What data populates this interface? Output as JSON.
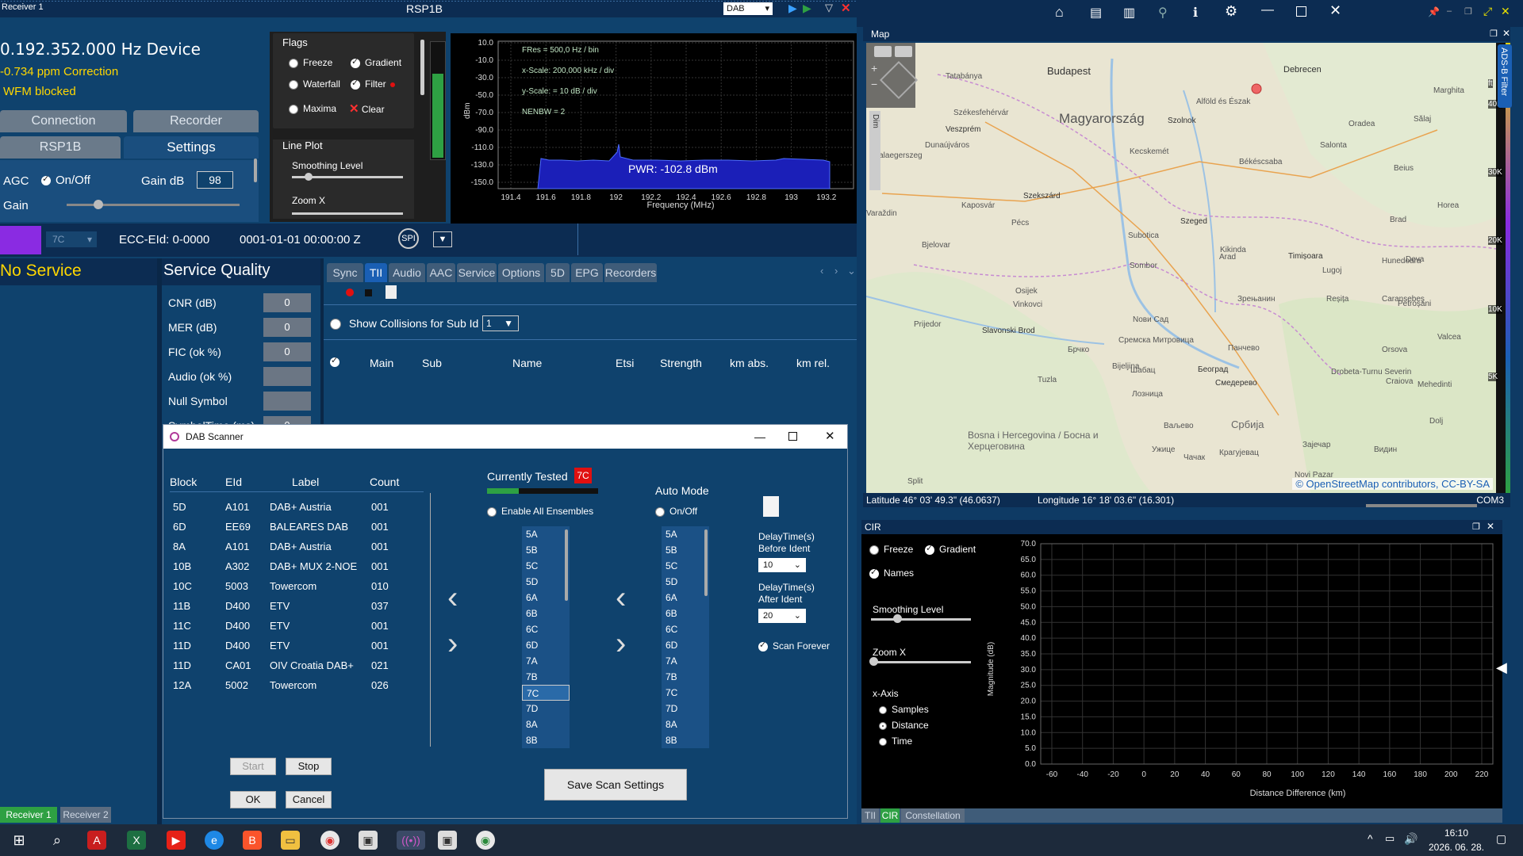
{
  "receiver": {
    "window_title": "Receiver 1",
    "device_title": "RSP1B",
    "mode": "DAB",
    "freq_line": "0.192.352.000 Hz Device",
    "ppm_line": "-0.734 ppm Correction",
    "wfm_line": "WFM blocked",
    "tabs": [
      "Connection",
      "Recorder",
      "RSP1B",
      "Settings"
    ],
    "agc_label": "AGC",
    "agc_toggle": "On/Off",
    "gain_db_label": "Gain dB",
    "gain_db_value": "98",
    "gain_label": "Gain"
  },
  "flags": {
    "title": "Flags",
    "freeze": "Freeze",
    "gradient": "Gradient",
    "waterfall": "Waterfall",
    "filter": "Filter",
    "maxima": "Maxima",
    "clear": "Clear"
  },
  "lineplot": {
    "title": "Line Plot",
    "smoothing": "Smoothing Level",
    "zoom": "Zoom X"
  },
  "spectrum": {
    "info": [
      "FRes = 500,0 Hz / bin",
      "x-Scale: 200,000 kHz / div",
      "y-Scale: = 10 dB / div",
      "NENBW = 2"
    ],
    "pwr": "PWR: -102.8 dBm",
    "ylabel": "dBm",
    "xlabel": "Frequency (MHz)",
    "yticks": [
      "10.0",
      "-10.0",
      "-30.0",
      "-50.0",
      "-70.0",
      "-90.0",
      "-110.0",
      "-130.0",
      "-150.0"
    ],
    "xticks": [
      "191.4",
      "191.6",
      "191.8",
      "192",
      "192.2",
      "192.4",
      "192.6",
      "192.8",
      "193",
      "193.2"
    ]
  },
  "status": {
    "channel": "7C",
    "ecc": "ECC-EId: 0-0000",
    "datetime": "0001-01-01  00:00:00 Z",
    "spi": "SPI",
    "no_service": "No Service"
  },
  "quality": {
    "title": "Service Quality",
    "rows": [
      {
        "label": "CNR (dB)",
        "value": "0"
      },
      {
        "label": "MER (dB)",
        "value": "0"
      },
      {
        "label": "FIC (ok %)",
        "value": "0"
      },
      {
        "label": "Audio (ok %)",
        "value": ""
      },
      {
        "label": "Null Symbol",
        "value": ""
      },
      {
        "label": "SymbolTime (ms)",
        "value": "0"
      }
    ]
  },
  "tii": {
    "tabs": [
      "Sync",
      "TII",
      "Audio",
      "AAC",
      "Service",
      "Options",
      "5D",
      "EPG",
      "Recorders"
    ],
    "collisions_label": "Show Collisions for Sub Id",
    "collisions_value": "1",
    "columns": [
      "Main",
      "Sub",
      "Name",
      "Etsi",
      "Strength",
      "km abs.",
      "km rel."
    ]
  },
  "scanner": {
    "title": "DAB Scanner",
    "headers": [
      "Block",
      "EId",
      "Label",
      "Count"
    ],
    "rows": [
      [
        "5D",
        "A101",
        "DAB+ Austria",
        "001"
      ],
      [
        "6D",
        "EE69",
        "BALEARES DAB",
        "001"
      ],
      [
        "8A",
        "A101",
        "DAB+ Austria",
        "001"
      ],
      [
        "10B",
        "A302",
        "DAB+ MUX 2-NOE",
        "001"
      ],
      [
        "10C",
        "5003",
        "Towercom",
        "010"
      ],
      [
        "11B",
        "D400",
        "ETV",
        "037"
      ],
      [
        "11C",
        "D400",
        "ETV",
        "001"
      ],
      [
        "11D",
        "D400",
        "ETV",
        "001"
      ],
      [
        "11D",
        "CA01",
        "OIV Croatia DAB+",
        "021"
      ],
      [
        "12A",
        "5002",
        "Towercom",
        "026"
      ]
    ],
    "currently_tested_label": "Currently Tested",
    "currently_tested_value": "7C",
    "enable_all": "Enable All Ensembles",
    "auto_mode": "Auto Mode",
    "auto_onoff": "On/Off",
    "channels": [
      "5A",
      "5B",
      "5C",
      "5D",
      "6A",
      "6B",
      "6C",
      "6D",
      "7A",
      "7B",
      "7C",
      "7D",
      "8A",
      "8B"
    ],
    "delay_before_label": "DelayTime(s) Before Ident",
    "delay_before_value": "10",
    "delay_after_label": "DelayTime(s) After Ident",
    "delay_after_value": "20",
    "scan_forever": "Scan Forever",
    "start": "Start",
    "stop": "Stop",
    "ok": "OK",
    "cancel": "Cancel",
    "save": "Save Scan Settings"
  },
  "map": {
    "title": "Map",
    "side_tab": "ADS-B Filter",
    "dim_label": "Dim",
    "cities": [
      "Budapest",
      "Magyarország",
      "Debrecen",
      "Tatabánya",
      "Székesfehérvár",
      "Szolnok",
      "Veszprém",
      "Kecskemét",
      "Salonta",
      "Oradea",
      "Zalaegerszeg",
      "Dunaújváros",
      "Békéscsaba",
      "Szekszárd",
      "Kaposvár",
      "Pécs",
      "Szeged",
      "Varaždin",
      "Bjelovar",
      "Subotica",
      "Timișoara",
      "Osijek",
      "Sombor",
      "Kikinda",
      "Lugoj",
      "Vinkovci",
      "Nови Сад",
      "Зрењанин",
      "Prijedor",
      "Slavonski Brod",
      "Брчко",
      "Сремска Митровица",
      "Панчево",
      "Bijeljina",
      "Шабац",
      "Београд",
      "Смедерево",
      "Tuzla",
      "Лозница",
      "Bosna i Hercegovina / Босна и Херцеговина",
      "Ваљево",
      "Србија",
      "Split",
      "Ужице",
      "Чачак",
      "Крагујевац",
      "Зајечар",
      "Видин",
      "Craiova",
      "Reșița",
      "Caransebeș",
      "Petroșani",
      "Drobeta-Turnu Severin",
      "Hunedoara",
      "Deva",
      "Arad",
      "Alföld és Észak",
      "Marghita",
      "Beius",
      "Brad",
      "Sălaj",
      "Horea",
      "Valcea",
      "Orsova",
      "Mehedinti",
      "Dolj",
      "Novi Pazar"
    ],
    "attribution": "© OpenStreetMap contributors, CC-BY-SA",
    "lat": "Latitude  46° 03' 49.3\" (46.0637)",
    "lon": "Longitude  16° 18' 03.6\" (16.301)",
    "com": "COM3",
    "scale_labels": [
      "ft",
      "40K",
      "30K",
      "20K",
      "10K",
      "5K"
    ]
  },
  "cir": {
    "title": "CIR",
    "freeze": "Freeze",
    "gradient": "Gradient",
    "names": "Names",
    "smoothing": "Smoothing Level",
    "zoom": "Zoom X",
    "xaxis": "x-Axis",
    "samples": "Samples",
    "distance": "Distance",
    "time": "Time",
    "ylabel": "Magnitude (dB)",
    "xlabel": "Distance Difference (km)",
    "yticks": [
      "70.0",
      "65.0",
      "60.0",
      "55.0",
      "50.0",
      "45.0",
      "40.0",
      "35.0",
      "30.0",
      "25.0",
      "20.0",
      "15.0",
      "10.0",
      "5.0",
      "0.0"
    ],
    "xticks": [
      "-60",
      "-40",
      "-20",
      "0",
      "20",
      "40",
      "60",
      "80",
      "100",
      "120",
      "140",
      "160",
      "180",
      "200",
      "220"
    ],
    "bottom_tabs": [
      "TII",
      "CIR",
      "Constellation"
    ]
  },
  "receiver_tabs": [
    "Receiver 1",
    "Receiver 2"
  ],
  "taskbar": {
    "time": "16:10",
    "date": "2026. 06. 28."
  },
  "colors": {
    "panel": "#0f426d",
    "accent_purple": "#8a2be2",
    "red": "#e01010",
    "green": "#2ea043",
    "yellow": "#ffd700"
  }
}
